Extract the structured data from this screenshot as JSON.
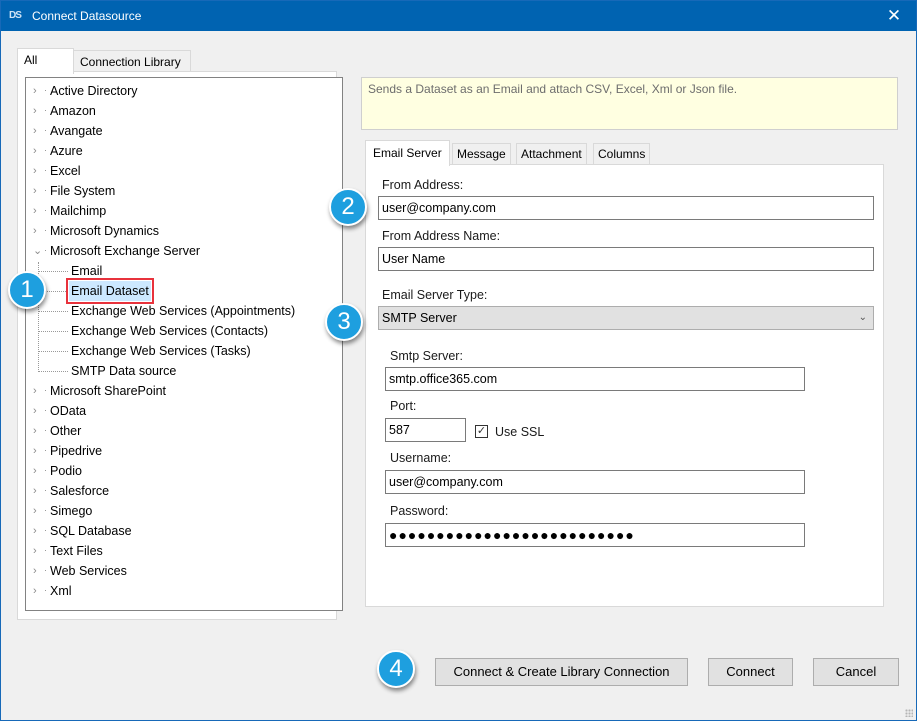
{
  "window": {
    "title": "Connect Datasource",
    "app_icon": "DS",
    "close_icon": "✕"
  },
  "left_tabs": [
    {
      "label": "All",
      "active": true
    },
    {
      "label": "Connection Library",
      "active": false
    }
  ],
  "tree": {
    "items": [
      {
        "label": "Active Directory",
        "expanded": false
      },
      {
        "label": "Amazon",
        "expanded": false
      },
      {
        "label": "Avangate",
        "expanded": false
      },
      {
        "label": "Azure",
        "expanded": false
      },
      {
        "label": "Excel",
        "expanded": false
      },
      {
        "label": "File System",
        "expanded": false
      },
      {
        "label": "Mailchimp",
        "expanded": false
      },
      {
        "label": "Microsoft Dynamics",
        "expanded": false
      },
      {
        "label": "Microsoft Exchange Server",
        "expanded": true
      },
      {
        "label": "Microsoft SharePoint",
        "expanded": false
      },
      {
        "label": "OData",
        "expanded": false
      },
      {
        "label": "Other",
        "expanded": false
      },
      {
        "label": "Pipedrive",
        "expanded": false
      },
      {
        "label": "Podio",
        "expanded": false
      },
      {
        "label": "Salesforce",
        "expanded": false
      },
      {
        "label": "Simego",
        "expanded": false
      },
      {
        "label": "SQL Database",
        "expanded": false
      },
      {
        "label": "Text Files",
        "expanded": false
      },
      {
        "label": "Web Services",
        "expanded": false
      },
      {
        "label": "Xml",
        "expanded": false
      }
    ],
    "children": [
      {
        "label": "Email",
        "selected": false
      },
      {
        "label": "Email Dataset",
        "selected": true
      },
      {
        "label": "Exchange Web Services (Appointments)",
        "selected": false
      },
      {
        "label": "Exchange Web Services (Contacts)",
        "selected": false
      },
      {
        "label": "Exchange Web Services (Tasks)",
        "selected": false
      },
      {
        "label": "SMTP Data source",
        "selected": false
      }
    ],
    "collapsed_icon": "›",
    "expanded_icon": "⌄"
  },
  "badges": [
    "1",
    "2",
    "3",
    "4"
  ],
  "description": "Sends a Dataset as an Email and attach CSV, Excel, Xml or Json file.",
  "right_tabs": [
    {
      "label": "Email Server",
      "active": true
    },
    {
      "label": "Message",
      "active": false
    },
    {
      "label": "Attachment",
      "active": false
    },
    {
      "label": "Columns",
      "active": false
    }
  ],
  "form": {
    "from_address": {
      "label": "From Address:",
      "value": "user@company.com"
    },
    "from_address_name": {
      "label": "From Address Name:",
      "value": "User Name"
    },
    "email_server_type": {
      "label": "Email Server Type:",
      "value": "SMTP Server"
    },
    "smtp_server": {
      "label": "Smtp Server:",
      "value": "smtp.office365.com"
    },
    "port": {
      "label": "Port:",
      "value": "587"
    },
    "use_ssl": {
      "label": "Use SSL",
      "checked": true,
      "check_glyph": "✓"
    },
    "username": {
      "label": "Username:",
      "value": "user@company.com"
    },
    "password": {
      "label": "Password:",
      "value": "●●●●●●●●●●●●●●●●●●●●●●●●●●"
    }
  },
  "buttons": {
    "connect_create": "Connect & Create Library Connection",
    "connect": "Connect",
    "cancel": "Cancel"
  },
  "colors": {
    "titlebar": "#0063b1",
    "badge": "#1e9fdf",
    "selection_outline": "#e8323c",
    "selection_fill": "#cce8ff",
    "description_bg": "#ffffe1"
  }
}
